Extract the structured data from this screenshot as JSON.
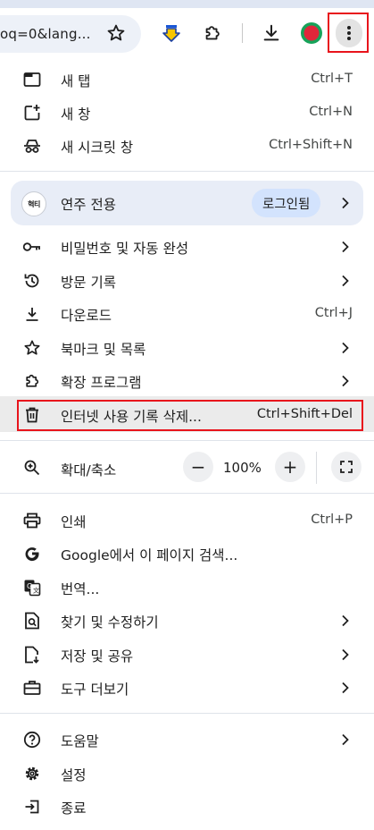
{
  "toolbar": {
    "url_fragment": "oq=0&lang...",
    "icons": [
      "bookmark-star-icon",
      "download-arrow-extension-icon",
      "extensions-puzzle-icon",
      "downloads-icon",
      "profile-avatar-icon",
      "kebab-menu-icon"
    ],
    "highlight_color": "#e8141c"
  },
  "menu": {
    "new_tab": {
      "label": "새 탭",
      "shortcut": "Ctrl+T"
    },
    "new_window": {
      "label": "새 창",
      "shortcut": "Ctrl+N"
    },
    "new_incognito": {
      "label": "새 시크릿 창",
      "shortcut": "Ctrl+Shift+N"
    },
    "profile": {
      "avatar_text": "혁티",
      "name": "연주 전용",
      "status": "로그인됨"
    },
    "passwords": {
      "label": "비밀번호 및 자동 완성"
    },
    "history": {
      "label": "방문 기록"
    },
    "downloads": {
      "label": "다운로드",
      "shortcut": "Ctrl+J"
    },
    "bookmarks": {
      "label": "북마크 및 목록"
    },
    "extensions": {
      "label": "확장 프로그램"
    },
    "clear_data": {
      "label": "인터넷 사용 기록 삭제...",
      "shortcut": "Ctrl+Shift+Del"
    },
    "zoom": {
      "label": "확대/축소",
      "minus": "−",
      "value": "100%",
      "plus": "+"
    },
    "print": {
      "label": "인쇄",
      "shortcut": "Ctrl+P"
    },
    "search_page": {
      "label": "Google에서 이 페이지 검색..."
    },
    "translate": {
      "label": "번역..."
    },
    "find_edit": {
      "label": "찾기 및 수정하기"
    },
    "save_share": {
      "label": "저장 및 공유"
    },
    "more_tools": {
      "label": "도구 더보기"
    },
    "help": {
      "label": "도움말"
    },
    "settings": {
      "label": "설정"
    },
    "exit": {
      "label": "종료"
    }
  }
}
